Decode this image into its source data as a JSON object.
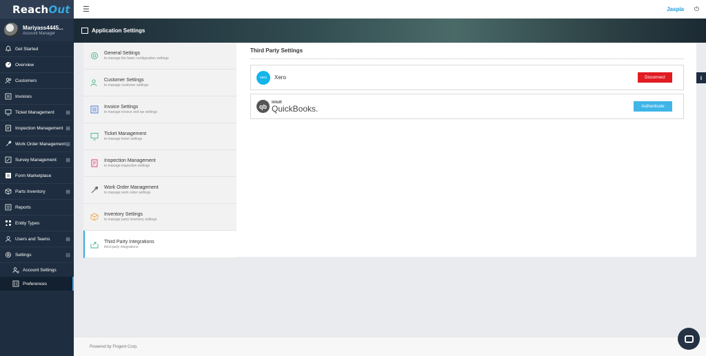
{
  "app": {
    "logo_main": "Reach",
    "logo_tail": "Out",
    "brand": "Jaspia"
  },
  "user": {
    "name": "Mariyass4445...",
    "role": "Account Manager"
  },
  "sidebar": {
    "items": [
      {
        "label": "Get Started",
        "icon": "bell-icon",
        "expand": ""
      },
      {
        "label": "Overview",
        "icon": "dashboard-icon",
        "expand": ""
      },
      {
        "label": "Customers",
        "icon": "users-icon",
        "expand": ""
      },
      {
        "label": "Invoices",
        "icon": "invoice-icon",
        "expand": ""
      },
      {
        "label": "Ticket Management",
        "icon": "monitor-icon",
        "expand": "⊞"
      },
      {
        "label": "Inspection Management",
        "icon": "clipboard-icon",
        "expand": "⊞"
      },
      {
        "label": "Work Order Management",
        "icon": "wrench-icon",
        "expand": "⊞"
      },
      {
        "label": "Survey Management",
        "icon": "survey-icon",
        "expand": "⊞"
      },
      {
        "label": "Form Marketplace",
        "icon": "form-icon",
        "expand": ""
      },
      {
        "label": "Parts Inventory",
        "icon": "box-icon",
        "expand": "⊞"
      },
      {
        "label": "Reports",
        "icon": "report-icon",
        "expand": ""
      },
      {
        "label": "Entity Types",
        "icon": "entity-icon",
        "expand": ""
      },
      {
        "label": "Users and Teams",
        "icon": "user-icon",
        "expand": "⊞"
      },
      {
        "label": "Settings",
        "icon": "gear-icon",
        "expand": "⊟"
      }
    ],
    "sub_items": [
      {
        "label": "Account Settings"
      },
      {
        "label": "Preferences"
      }
    ]
  },
  "banner": {
    "title": "Application Settings"
  },
  "settings_menu": [
    {
      "title": "General Settings",
      "subtitle": "to manage the basic configuration settings",
      "icon": "gear-icon",
      "color": "#3cb38a"
    },
    {
      "title": "Customer Settings",
      "subtitle": "to manage customer settings",
      "icon": "users-icon",
      "color": "#3cb38a"
    },
    {
      "title": "Invoice Settings",
      "subtitle": "to manage invoice and tax settings",
      "icon": "invoice-icon",
      "color": "#3b6fd1"
    },
    {
      "title": "Ticket Management",
      "subtitle": "to manage ticket settings",
      "icon": "monitor-icon",
      "color": "#3cb38a"
    },
    {
      "title": "Inspection Management",
      "subtitle": "to manage inspection settings",
      "icon": "clipboard-icon",
      "color": "#d8336b"
    },
    {
      "title": "Work Order Management",
      "subtitle": "to manage work order settings",
      "icon": "wrench-icon",
      "color": "#555555"
    },
    {
      "title": "Inventory Settings",
      "subtitle": "to manage parts inventory settings",
      "icon": "box-icon",
      "color": "#f0a030"
    },
    {
      "title": "Third Party Integrations",
      "subtitle": "third party integrations",
      "icon": "export-icon",
      "color": "#3cb38a"
    }
  ],
  "content": {
    "title": "Third Party Settings",
    "integrations": [
      {
        "name": "Xero",
        "logo_text": "xero",
        "button": "Disconnect",
        "button_color": "#e01b22"
      },
      {
        "name": "QuickBooks.",
        "logo_text": "qb",
        "intuit": "intuit",
        "button": "Authenticate",
        "button_color": "#3fb5e8"
      }
    ]
  },
  "footer": {
    "text": "Powered by Fingent Corp."
  },
  "info_tab": {
    "label": "i"
  }
}
